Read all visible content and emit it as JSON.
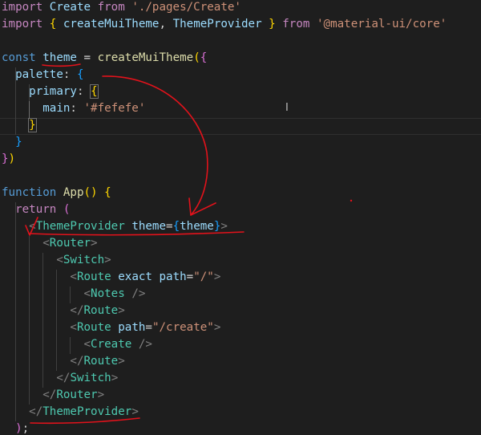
{
  "editor": {
    "lines": [
      [
        [
          "k",
          "import"
        ],
        [
          "p",
          " "
        ],
        [
          "v",
          "Create"
        ],
        [
          "p",
          " "
        ],
        [
          "k",
          "from"
        ],
        [
          "p",
          " "
        ],
        [
          "s",
          "'./pages/Create'"
        ]
      ],
      [
        [
          "k",
          "import"
        ],
        [
          "p",
          " "
        ],
        [
          "br",
          "{"
        ],
        [
          "p",
          " "
        ],
        [
          "v",
          "createMuiTheme"
        ],
        [
          "p",
          ", "
        ],
        [
          "v",
          "ThemeProvider"
        ],
        [
          "p",
          " "
        ],
        [
          "br",
          "}"
        ],
        [
          "p",
          " "
        ],
        [
          "k",
          "from"
        ],
        [
          "p",
          " "
        ],
        [
          "s",
          "'@material-ui/core'"
        ]
      ],
      [],
      [
        [
          "kb",
          "const"
        ],
        [
          "p",
          " "
        ],
        [
          "v",
          "theme"
        ],
        [
          "p",
          " = "
        ],
        [
          "f",
          "createMuiTheme"
        ],
        [
          "br",
          "("
        ],
        [
          "bp",
          "{"
        ]
      ],
      [
        [
          "p",
          "  "
        ],
        [
          "v",
          "palette"
        ],
        [
          "p",
          ": "
        ],
        [
          "bb",
          "{"
        ]
      ],
      [
        [
          "p",
          "    "
        ],
        [
          "v",
          "primary"
        ],
        [
          "p",
          ": "
        ],
        [
          "br",
          "{"
        ]
      ],
      [
        [
          "p",
          "      "
        ],
        [
          "v",
          "main"
        ],
        [
          "p",
          ": "
        ],
        [
          "s",
          "'#fefefe'"
        ]
      ],
      [
        [
          "p",
          "    "
        ],
        [
          "br",
          "}"
        ]
      ],
      [
        [
          "p",
          "  "
        ],
        [
          "bb",
          "}"
        ]
      ],
      [
        [
          "bp",
          "}"
        ],
        [
          "br",
          ")"
        ]
      ],
      [],
      [
        [
          "kb",
          "function"
        ],
        [
          "p",
          " "
        ],
        [
          "f",
          "App"
        ],
        [
          "br",
          "()"
        ],
        [
          "p",
          " "
        ],
        [
          "br",
          "{"
        ]
      ],
      [
        [
          "p",
          "  "
        ],
        [
          "k",
          "return"
        ],
        [
          "p",
          " "
        ],
        [
          "bp",
          "("
        ]
      ],
      [
        [
          "p",
          "    "
        ],
        [
          "g",
          "<"
        ],
        [
          "t",
          "ThemeProvider"
        ],
        [
          "p",
          " "
        ],
        [
          "a",
          "theme"
        ],
        [
          "p",
          "="
        ],
        [
          "bb",
          "{"
        ],
        [
          "v",
          "theme"
        ],
        [
          "bb",
          "}"
        ],
        [
          "g",
          ">"
        ]
      ],
      [
        [
          "p",
          "      "
        ],
        [
          "g",
          "<"
        ],
        [
          "t",
          "Router"
        ],
        [
          "g",
          ">"
        ]
      ],
      [
        [
          "p",
          "        "
        ],
        [
          "g",
          "<"
        ],
        [
          "t",
          "Switch"
        ],
        [
          "g",
          ">"
        ]
      ],
      [
        [
          "p",
          "          "
        ],
        [
          "g",
          "<"
        ],
        [
          "t",
          "Route"
        ],
        [
          "p",
          " "
        ],
        [
          "a",
          "exact"
        ],
        [
          "p",
          " "
        ],
        [
          "a",
          "path"
        ],
        [
          "p",
          "="
        ],
        [
          "s",
          "\"/\""
        ],
        [
          "g",
          ">"
        ]
      ],
      [
        [
          "p",
          "            "
        ],
        [
          "g",
          "<"
        ],
        [
          "t",
          "Notes"
        ],
        [
          "p",
          " "
        ],
        [
          "g",
          "/>"
        ]
      ],
      [
        [
          "p",
          "          "
        ],
        [
          "g",
          "</"
        ],
        [
          "t",
          "Route"
        ],
        [
          "g",
          ">"
        ]
      ],
      [
        [
          "p",
          "          "
        ],
        [
          "g",
          "<"
        ],
        [
          "t",
          "Route"
        ],
        [
          "p",
          " "
        ],
        [
          "a",
          "path"
        ],
        [
          "p",
          "="
        ],
        [
          "s",
          "\"/create\""
        ],
        [
          "g",
          ">"
        ]
      ],
      [
        [
          "p",
          "            "
        ],
        [
          "g",
          "<"
        ],
        [
          "t",
          "Create"
        ],
        [
          "p",
          " "
        ],
        [
          "g",
          "/>"
        ]
      ],
      [
        [
          "p",
          "          "
        ],
        [
          "g",
          "</"
        ],
        [
          "t",
          "Route"
        ],
        [
          "g",
          ">"
        ]
      ],
      [
        [
          "p",
          "        "
        ],
        [
          "g",
          "</"
        ],
        [
          "t",
          "Switch"
        ],
        [
          "g",
          ">"
        ]
      ],
      [
        [
          "p",
          "      "
        ],
        [
          "g",
          "</"
        ],
        [
          "t",
          "Router"
        ],
        [
          "g",
          ">"
        ]
      ],
      [
        [
          "p",
          "    "
        ],
        [
          "g",
          "</"
        ],
        [
          "t",
          "ThemeProvider"
        ],
        [
          "g",
          ">"
        ]
      ],
      [
        [
          "p",
          "  "
        ],
        [
          "bp",
          ")"
        ],
        [
          "p",
          ";"
        ]
      ]
    ],
    "cursor_symbol": "I"
  },
  "colors": {
    "background": "#1e1e1e",
    "annotation_ink": "#e3121b"
  }
}
